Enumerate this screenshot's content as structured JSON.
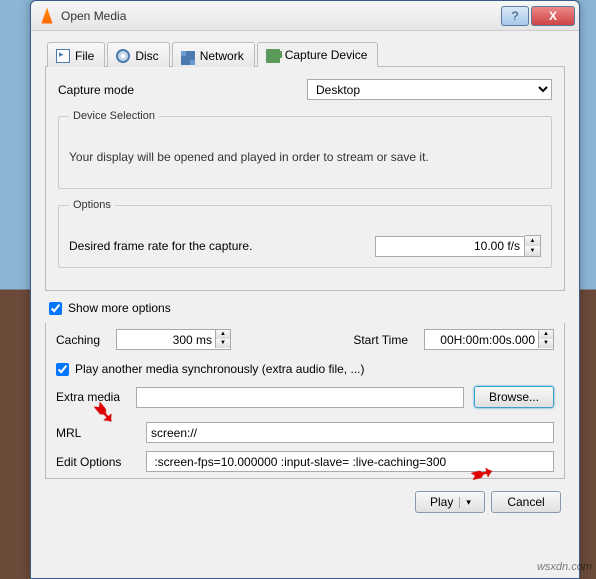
{
  "window": {
    "title": "Open Media",
    "help": "?",
    "close": "X"
  },
  "tabs": {
    "file": "File",
    "disc": "Disc",
    "network": "Network",
    "capture": "Capture Device"
  },
  "capture": {
    "mode_label": "Capture mode",
    "mode_value": "Desktop",
    "device_selection": {
      "legend": "Device Selection",
      "note": "Your display will be opened and played in order to stream or save it."
    },
    "options": {
      "legend": "Options",
      "framerate_label": "Desired frame rate for the capture.",
      "framerate_value": "10.00 f/s"
    }
  },
  "show_more": "Show more options",
  "more": {
    "caching_label": "Caching",
    "caching_value": "300 ms",
    "start_time_label": "Start Time",
    "start_time_value": "00H:00m:00s.000",
    "play_sync_label": "Play another media synchronously (extra audio file, ...)",
    "extra_media_label": "Extra media",
    "extra_media_value": "",
    "browse": "Browse...",
    "mrl_label": "MRL",
    "mrl_value": "screen://",
    "edit_options_label": "Edit Options",
    "edit_options_value": " :screen-fps=10.000000 :input-slave= :live-caching=300"
  },
  "footer": {
    "play": "Play",
    "cancel": "Cancel"
  },
  "watermark": "wsxdn.com"
}
